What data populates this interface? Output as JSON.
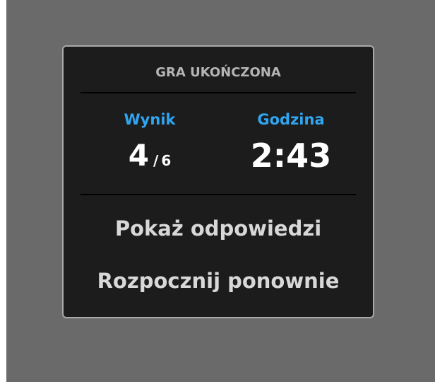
{
  "dialog": {
    "title": "GRA UKOŃCZONA",
    "score": {
      "label": "Wynik",
      "value": "4",
      "separator": "/",
      "total": "6"
    },
    "time": {
      "label": "Godzina",
      "value": "2:43"
    },
    "actions": {
      "show_answers": "Pokaż odpowiedzi",
      "restart": "Rozpocznij ponownie"
    }
  },
  "colors": {
    "backdrop": "#6a6a6a",
    "dialog_background": "#1c1c1c",
    "dialog_border": "#a9a9a9",
    "accent": "#30a5f0",
    "title": "#b5b5b5",
    "value": "#ffffff",
    "action": "#d8d8d8"
  }
}
